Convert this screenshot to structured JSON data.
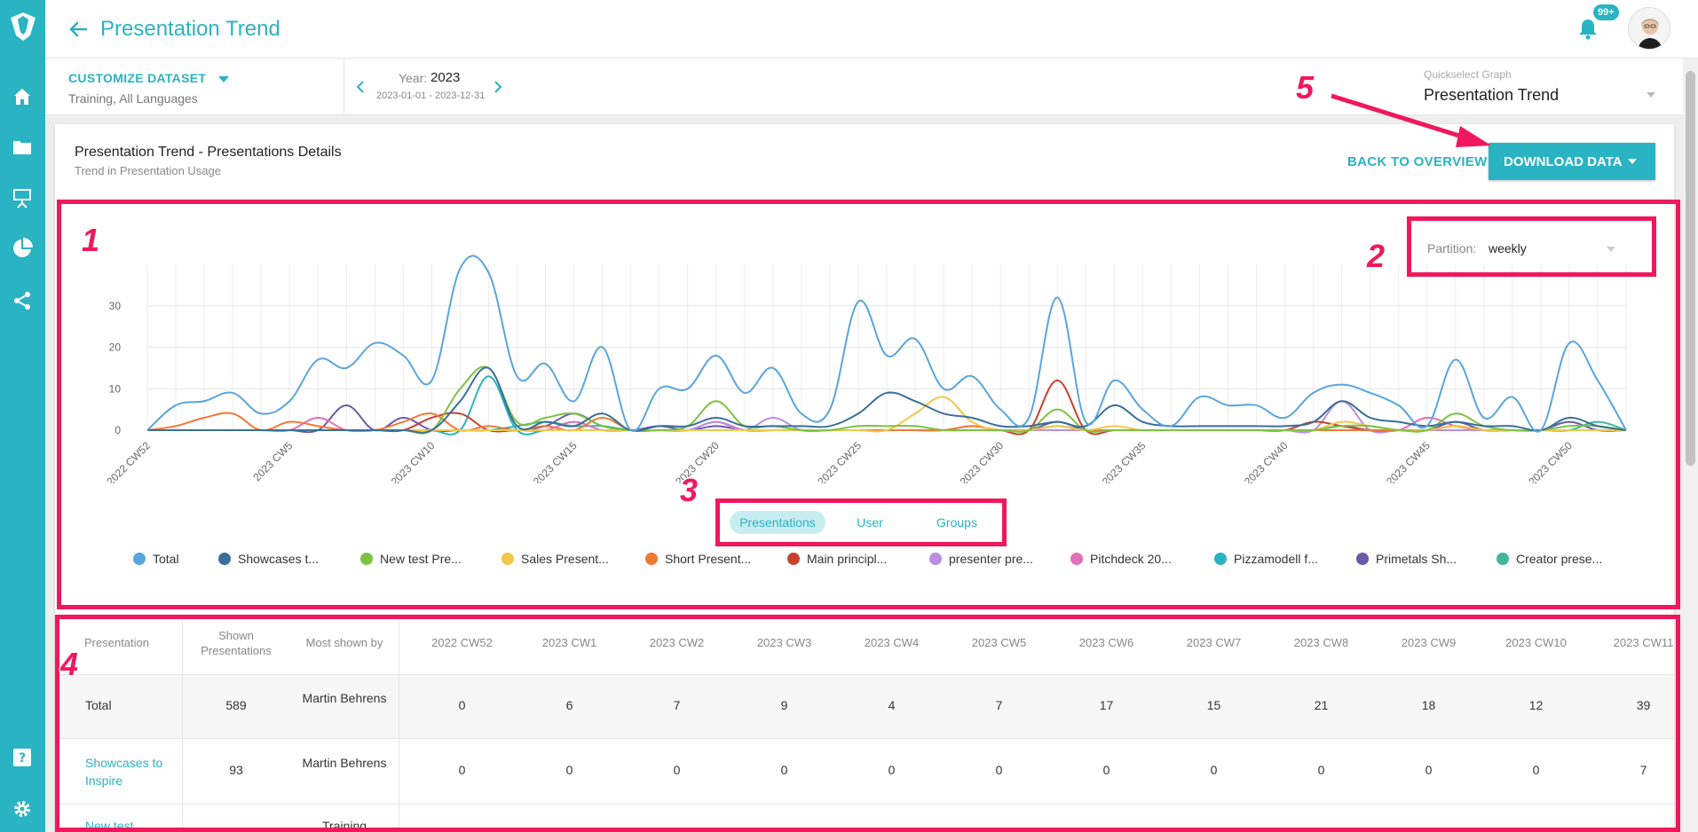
{
  "header": {
    "title": "Presentation Trend",
    "badge": "99+"
  },
  "sidebar": {
    "items": [
      "home-icon",
      "folder-icon",
      "presentation-icon",
      "chart-pie-icon",
      "share-icon",
      "help-icon",
      "gear-icon"
    ]
  },
  "filters": {
    "customize_label": "CUSTOMIZE DATASET",
    "dataset_sub": "Training, All Languages",
    "year_label": "Year:",
    "year_value": "2023",
    "year_range": "2023-01-01 - 2023-12-31",
    "quickselect_label": "Quickselect Graph",
    "quickselect_value": "Presentation Trend"
  },
  "card": {
    "title": "Presentation Trend - Presentations Details",
    "subtitle": "Trend in Presentation Usage",
    "back_label": "BACK TO OVERVIEW",
    "download_label": "DOWNLOAD DATA"
  },
  "partition": {
    "label": "Partition:",
    "value": "weekly"
  },
  "tabs": [
    "Presentations",
    "User",
    "Groups"
  ],
  "legend": [
    {
      "name": "Total",
      "color": "#5aa5dc"
    },
    {
      "name": "Showcases t...",
      "color": "#3a6f9a"
    },
    {
      "name": "New test Pre...",
      "color": "#7cc242"
    },
    {
      "name": "Sales Present...",
      "color": "#f1c84a"
    },
    {
      "name": "Short Present...",
      "color": "#ee7a35"
    },
    {
      "name": "Main principl...",
      "color": "#c8402f"
    },
    {
      "name": "presenter pre...",
      "color": "#b98ee0"
    },
    {
      "name": "Pitchdeck 20...",
      "color": "#e070b8"
    },
    {
      "name": "Pizzamodell f...",
      "color": "#2ab3c2"
    },
    {
      "name": "Primetals Sh...",
      "color": "#6a5aa8"
    },
    {
      "name": "Creator prese...",
      "color": "#3db89a"
    }
  ],
  "chart_data": {
    "type": "line",
    "x": [
      "2022 CW52",
      "2023 CW1",
      "2023 CW2",
      "2023 CW3",
      "2023 CW4",
      "2023 CW5",
      "2023 CW6",
      "2023 CW7",
      "2023 CW8",
      "2023 CW9",
      "2023 CW10",
      "2023 CW11",
      "2023 CW12",
      "2023 CW13",
      "2023 CW14",
      "2023 CW15",
      "2023 CW16",
      "2023 CW17",
      "2023 CW18",
      "2023 CW19",
      "2023 CW20",
      "2023 CW21",
      "2023 CW22",
      "2023 CW23",
      "2023 CW24",
      "2023 CW25",
      "2023 CW26",
      "2023 CW27",
      "2023 CW28",
      "2023 CW29",
      "2023 CW30",
      "2023 CW31",
      "2023 CW32",
      "2023 CW33",
      "2023 CW34",
      "2023 CW35",
      "2023 CW36",
      "2023 CW37",
      "2023 CW38",
      "2023 CW39",
      "2023 CW40",
      "2023 CW41",
      "2023 CW42",
      "2023 CW43",
      "2023 CW44",
      "2023 CW45",
      "2023 CW46",
      "2023 CW47",
      "2023 CW48",
      "2023 CW49",
      "2023 CW50",
      "2023 CW51",
      "2023 CW52"
    ],
    "xticks": [
      "2022 CW52",
      "2023 CW5",
      "2023 CW10",
      "2023 CW15",
      "2023 CW20",
      "2023 CW25",
      "2023 CW30",
      "2023 CW35",
      "2023 CW40",
      "2023 CW45",
      "2023 CW50"
    ],
    "ylim": [
      0,
      40
    ],
    "yticks": [
      0,
      10,
      20,
      30
    ],
    "series": [
      {
        "name": "Total",
        "values": [
          0,
          6,
          7,
          9,
          4,
          7,
          17,
          15,
          21,
          18,
          12,
          39,
          38,
          13,
          16,
          7,
          20,
          0,
          10,
          10,
          18,
          9,
          15,
          4,
          5,
          31,
          18,
          22,
          10,
          13,
          5,
          3,
          32,
          2,
          12,
          5,
          1,
          8,
          6,
          6,
          3,
          9,
          11,
          9,
          6,
          1,
          17,
          3,
          8,
          0,
          21,
          12,
          0
        ]
      },
      {
        "name": "Showcases t...",
        "values": [
          0,
          0,
          0,
          0,
          0,
          0,
          0,
          0,
          0,
          0,
          0,
          7,
          15,
          1,
          2,
          1,
          4,
          0,
          1,
          1,
          3,
          1,
          1,
          1,
          1,
          4,
          9,
          7,
          4,
          3,
          1,
          1,
          2,
          1,
          6,
          2,
          1,
          1,
          1,
          1,
          1,
          2,
          7,
          3,
          2,
          1,
          2,
          1,
          1,
          0,
          3,
          1,
          0
        ]
      },
      {
        "name": "New test Pre...",
        "values": [
          0,
          0,
          0,
          0,
          0,
          0,
          0,
          0,
          0,
          0,
          0,
          10,
          15,
          2,
          3,
          4,
          1,
          0,
          0,
          1,
          7,
          1,
          1,
          0,
          0,
          1,
          1,
          1,
          0,
          0,
          0,
          0,
          5,
          0,
          0,
          0,
          0,
          0,
          0,
          0,
          0,
          0,
          1,
          1,
          0,
          0,
          4,
          1,
          0,
          0,
          1,
          1,
          0
        ]
      },
      {
        "name": "Sales Present...",
        "values": [
          0,
          0,
          0,
          0,
          0,
          0,
          0,
          0,
          0,
          0,
          0,
          0,
          0,
          0,
          0,
          0,
          0,
          0,
          0,
          0,
          0,
          0,
          0,
          0,
          0,
          0,
          0,
          4,
          8,
          2,
          0,
          0,
          1,
          0,
          1,
          0,
          0,
          0,
          0,
          0,
          0,
          0,
          2,
          1,
          0,
          0,
          1,
          0,
          0,
          0,
          0,
          0,
          0
        ]
      },
      {
        "name": "Short Present...",
        "values": [
          0,
          1,
          3,
          4,
          0,
          2,
          1,
          0,
          0,
          2,
          4,
          0,
          1,
          0,
          1,
          0,
          3,
          0,
          0,
          0,
          0,
          0,
          0,
          0,
          0,
          0,
          0,
          0,
          0,
          1,
          0,
          0,
          1,
          0,
          0,
          0,
          0,
          0,
          0,
          0,
          0,
          0,
          0,
          0,
          0,
          0,
          1,
          0,
          0,
          0,
          0,
          0,
          0
        ]
      },
      {
        "name": "Main principl...",
        "values": [
          0,
          0,
          0,
          0,
          0,
          0,
          0,
          0,
          0,
          0,
          3,
          4,
          0,
          0,
          0,
          0,
          0,
          0,
          0,
          0,
          0,
          0,
          0,
          0,
          0,
          0,
          0,
          0,
          0,
          1,
          0,
          0,
          12,
          0,
          0,
          0,
          0,
          0,
          0,
          0,
          0,
          2,
          1,
          0,
          0,
          0,
          1,
          0,
          0,
          0,
          0,
          0,
          0
        ]
      },
      {
        "name": "presenter pre...",
        "values": [
          0,
          0,
          0,
          0,
          0,
          0,
          0,
          0,
          0,
          0,
          0,
          0,
          0,
          0,
          0,
          0,
          0,
          0,
          0,
          0,
          2,
          0,
          3,
          0,
          0,
          0,
          0,
          0,
          0,
          0,
          0,
          0,
          0,
          0,
          0,
          0,
          0,
          0,
          0,
          0,
          0,
          0,
          7,
          0,
          0,
          0,
          0,
          0,
          0,
          0,
          0,
          0,
          0
        ]
      },
      {
        "name": "Pitchdeck 20...",
        "values": [
          0,
          0,
          0,
          0,
          0,
          0,
          3,
          0,
          0,
          0,
          0,
          0,
          0,
          0,
          0,
          2,
          0,
          0,
          0,
          0,
          2,
          0,
          0,
          0,
          0,
          0,
          0,
          0,
          0,
          0,
          0,
          0,
          0,
          0,
          0,
          0,
          0,
          0,
          0,
          0,
          0,
          0,
          0,
          0,
          0,
          3,
          1,
          0,
          0,
          0,
          0,
          0,
          0
        ]
      },
      {
        "name": "Pizzamodell f...",
        "values": [
          0,
          0,
          0,
          0,
          0,
          0,
          0,
          0,
          0,
          0,
          0,
          0,
          13,
          0,
          0,
          0,
          0,
          0,
          0,
          0,
          0,
          0,
          0,
          0,
          0,
          0,
          0,
          0,
          0,
          0,
          0,
          0,
          1,
          0,
          0,
          0,
          0,
          0,
          0,
          0,
          0,
          0,
          0,
          0,
          0,
          0,
          0,
          0,
          0,
          0,
          0,
          0,
          0
        ]
      },
      {
        "name": "Primetals Sh...",
        "values": [
          0,
          0,
          0,
          0,
          0,
          0,
          0,
          6,
          0,
          3,
          0,
          0,
          0,
          0,
          1,
          4,
          1,
          0,
          1,
          0,
          1,
          0,
          0,
          0,
          0,
          0,
          0,
          0,
          0,
          0,
          0,
          0,
          2,
          0,
          0,
          0,
          0,
          0,
          0,
          0,
          0,
          0,
          1,
          0,
          0,
          0,
          2,
          0,
          0,
          0,
          2,
          0,
          0
        ]
      },
      {
        "name": "Creator prese...",
        "values": [
          0,
          0,
          0,
          0,
          0,
          0,
          0,
          0,
          0,
          0,
          0,
          0,
          0,
          1,
          2,
          1,
          1,
          0,
          0,
          0,
          0,
          0,
          0,
          0,
          0,
          0,
          0,
          0,
          0,
          0,
          0,
          0,
          0,
          0,
          0,
          0,
          0,
          0,
          0,
          0,
          0,
          0,
          0,
          0,
          0,
          0,
          0,
          0,
          0,
          0,
          0,
          2,
          0
        ]
      }
    ]
  },
  "table": {
    "headers": {
      "presentation": "Presentation",
      "shown": "Shown Presentations",
      "most_shown": "Most shown by"
    },
    "weeks": [
      "2022 CW52",
      "2023 CW1",
      "2023 CW2",
      "2023 CW3",
      "2023 CW4",
      "2023 CW5",
      "2023 CW6",
      "2023 CW7",
      "2023 CW8",
      "2023 CW9",
      "2023 CW10",
      "2023 CW11"
    ],
    "rows": [
      {
        "name": "Total",
        "shown": "589",
        "by": "Martin Behrens",
        "values": [
          "0",
          "6",
          "7",
          "9",
          "4",
          "7",
          "17",
          "15",
          "21",
          "18",
          "12",
          "39"
        ]
      },
      {
        "name": "Showcases to Inspire",
        "shown": "93",
        "by": "Martin Behrens",
        "values": [
          "0",
          "0",
          "0",
          "0",
          "0",
          "0",
          "0",
          "0",
          "0",
          "0",
          "0",
          "7"
        ]
      },
      {
        "name": "New test",
        "shown": "",
        "by": "Training",
        "values": []
      }
    ]
  },
  "annotations": [
    "1",
    "2",
    "3",
    "4",
    "5"
  ]
}
